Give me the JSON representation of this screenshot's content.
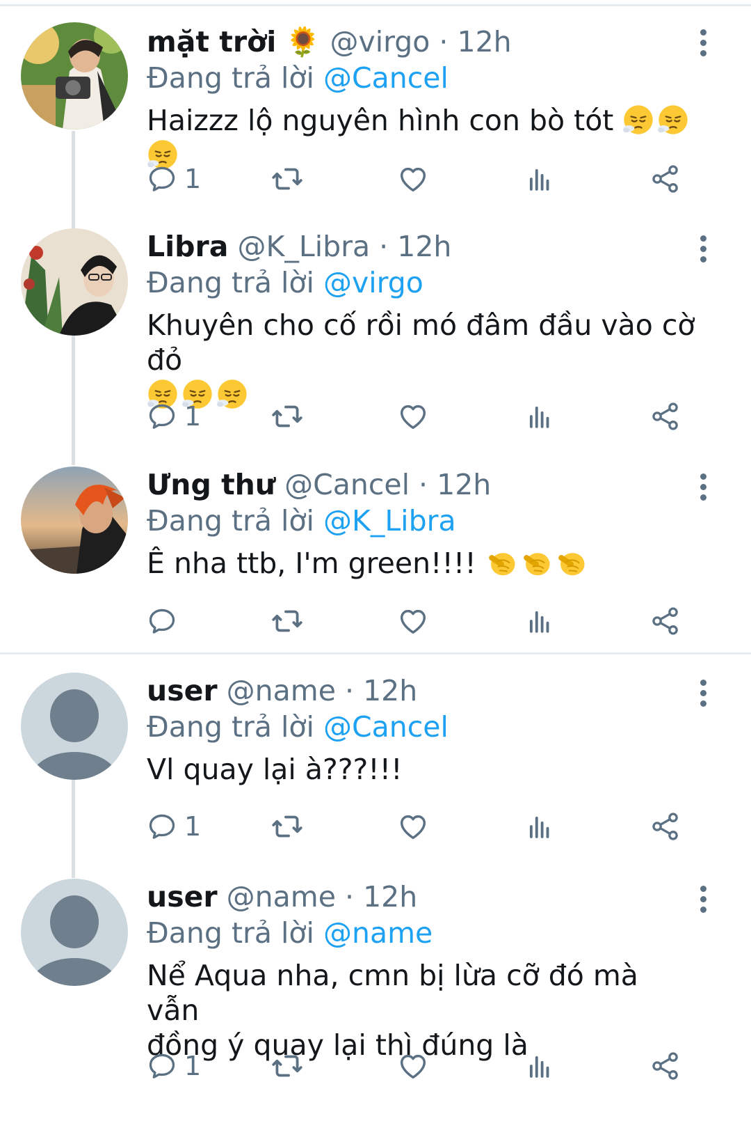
{
  "tweets": [
    {
      "name": "mặt trời",
      "name_emoji": "🌻",
      "handle": "@virgo",
      "time": "12h",
      "reply_prefix": "Đang trả lời",
      "reply_to": "@Cancel",
      "text": "Haizzz lộ nguyên hình con bò tót",
      "emojis": [
        "relieved-puff-face",
        "relieved-puff-face",
        "relieved-puff-face"
      ],
      "reply_count": "1",
      "avatar": "photo-man-with-camera"
    },
    {
      "name": "Libra",
      "handle": "@K_Libra",
      "time": "12h",
      "reply_prefix": "Đang trả lời",
      "reply_to": "@virgo",
      "text": "Khuyên cho cố rồi mó đâm đầu vào cờ đỏ",
      "emojis": [
        "relieved-puff-face",
        "relieved-puff-face",
        "relieved-puff-face"
      ],
      "reply_count": "1",
      "avatar": "photo-man-with-glasses-and-plants"
    },
    {
      "name": "Ưng thư",
      "handle": "@Cancel",
      "time": "12h",
      "reply_prefix": "Đang trả lời",
      "reply_to": "@K_Libra",
      "text": "Ê nha ttb, I'm green!!!!",
      "emojis": [
        "pointing-fist",
        "pointing-fist",
        "pointing-fist"
      ],
      "reply_count": "",
      "avatar": "photo-orange-hair-sunset"
    },
    {
      "name": "user",
      "handle": "@name",
      "time": "12h",
      "reply_prefix": "Đang trả lời",
      "reply_to": "@Cancel",
      "text": "Vl quay lại à???!!!",
      "emojis": [],
      "reply_count": "1",
      "avatar": "default-avatar"
    },
    {
      "name": "user",
      "handle": "@name",
      "time": "12h",
      "reply_prefix": "Đang trả lời",
      "reply_to": "@name",
      "text_line1": "Nể Aqua nha, cmn bị lừa cỡ đó mà vẫn",
      "text_line2": "đồng ý quay lại thì đúng là",
      "emojis": [],
      "reply_count": "1",
      "avatar": "default-avatar"
    }
  ],
  "dot": "·",
  "colors": {
    "link": "#1da1f2",
    "muted": "#5b7083",
    "text": "#14171a",
    "divider": "#e6ecf0"
  }
}
